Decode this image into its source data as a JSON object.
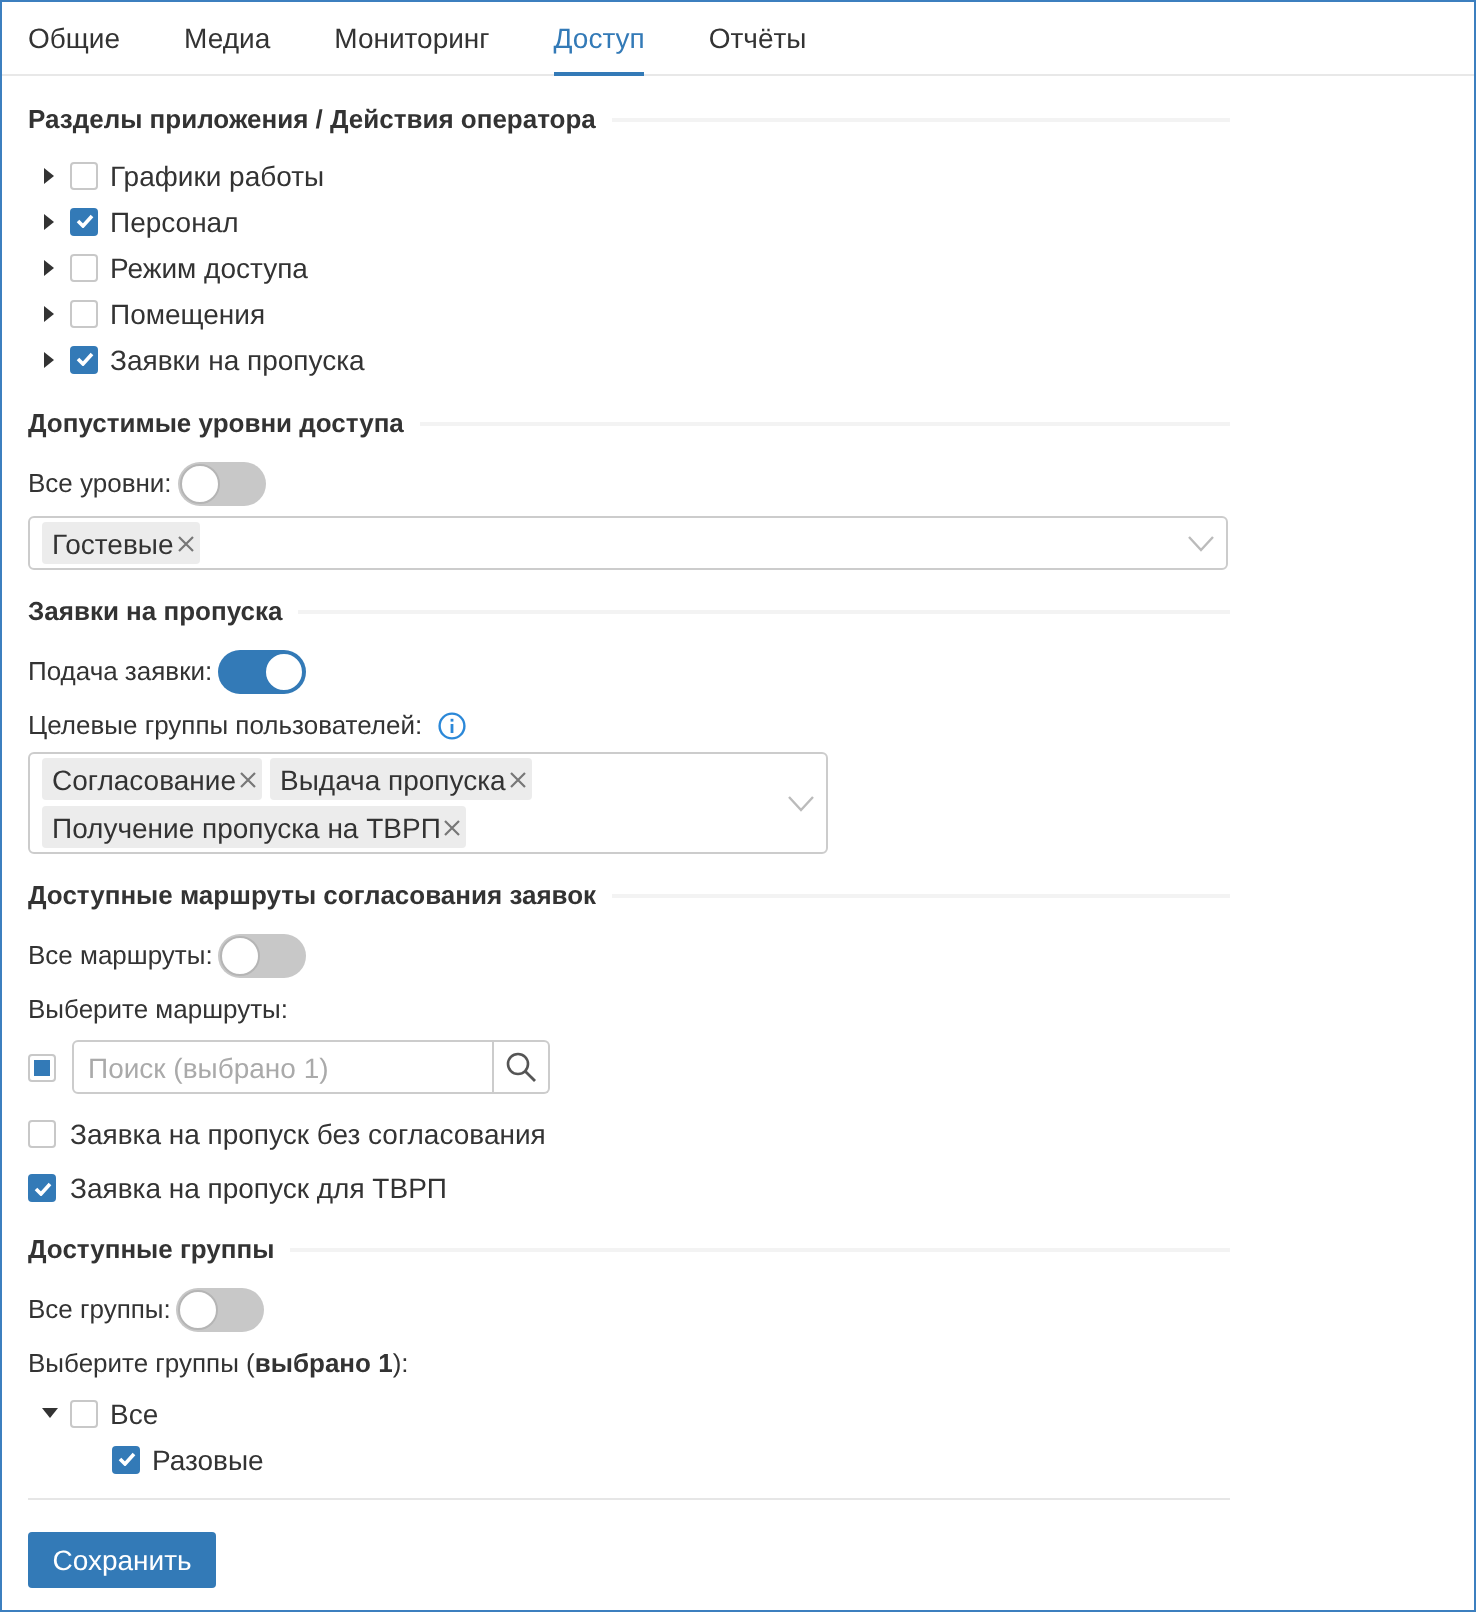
{
  "tabs": [
    {
      "label": "Общие",
      "selected": false
    },
    {
      "label": "Медиа",
      "selected": false
    },
    {
      "label": "Мониторинг",
      "selected": false
    },
    {
      "label": "Доступ",
      "selected": true
    },
    {
      "label": "Отчёты",
      "selected": false
    }
  ],
  "sections": [
    {
      "title": "Разделы приложения / Действия оператора",
      "controls": [
        {
          "kind": "tree",
          "nodes": [
            {
              "label": "Графики работы",
              "expanded": false,
              "checked": false
            },
            {
              "label": "Персонал",
              "expanded": false,
              "checked": true
            },
            {
              "label": "Режим доступа",
              "expanded": false,
              "checked": false
            },
            {
              "label": "Помещения",
              "expanded": false,
              "checked": false
            },
            {
              "label": "Заявки на пропуска",
              "expanded": false,
              "checked": true
            }
          ]
        }
      ]
    },
    {
      "title": "Допустимые уровни доступа",
      "controls": [
        {
          "kind": "toggle",
          "label": "Все уровни:",
          "on": false
        },
        {
          "kind": "multiselect",
          "tags": [
            "Гостевые"
          ]
        }
      ]
    },
    {
      "title": "Заявки на пропуска",
      "controls": [
        {
          "kind": "toggle",
          "label": "Подача заявки:",
          "on": true
        },
        {
          "kind": "label",
          "text": "Целевые группы пользователей:",
          "info": true
        },
        {
          "kind": "multiselect",
          "tags": [
            "Согласование",
            "Выдача пропуска",
            "Получение пропуска на ТВРП"
          ]
        }
      ]
    },
    {
      "title": "Доступные маршруты согласования заявок",
      "controls": [
        {
          "kind": "toggle",
          "label": "Все маршруты:",
          "on": false
        },
        {
          "kind": "label",
          "text": "Выберите маршруты:"
        },
        {
          "kind": "search",
          "checked": false,
          "indeterminate": true,
          "placeholder": "Поиск (выбрано 1)"
        },
        {
          "kind": "checkbox",
          "label": "Заявка на пропуск без согласования",
          "checked": false
        },
        {
          "kind": "checkbox",
          "label": "Заявка на пропуск для ТВРП",
          "checked": true
        }
      ]
    },
    {
      "title": "Доступные группы",
      "controls": [
        {
          "kind": "toggle",
          "label": "Все группы:",
          "on": false
        },
        {
          "kind": "label",
          "text": "Выберите группы (**выбрано 1**):"
        },
        {
          "kind": "tree",
          "nodes": [
            {
              "label": "Все",
              "expanded": true,
              "checked": false,
              "children": [
                {
                  "label": "Разовые",
                  "checked": true
                }
              ]
            }
          ]
        }
      ]
    }
  ],
  "save_button": "Сохранить"
}
